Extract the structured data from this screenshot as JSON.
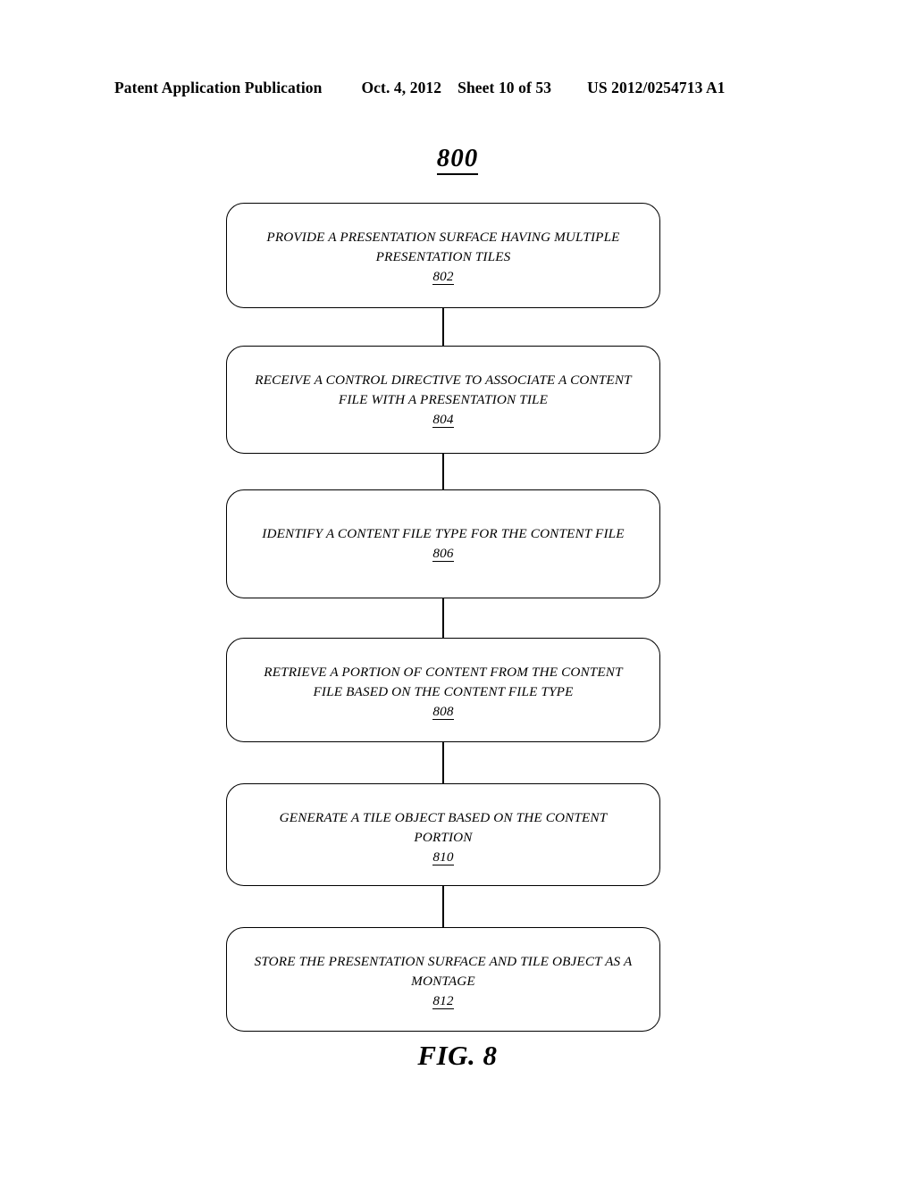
{
  "header": {
    "publication": "Patent Application Publication",
    "date": "Oct. 4, 2012",
    "sheet": "Sheet 10 of 53",
    "document_number": "US 2012/0254713 A1"
  },
  "figure": {
    "reference_number": "800",
    "caption": "FIG. 8"
  },
  "flowchart": {
    "nodes": [
      {
        "id": "802",
        "lines": [
          "PROVIDE A PRESENTATION SURFACE HAVING MULTIPLE",
          "PRESENTATION TILES"
        ],
        "ref": "802"
      },
      {
        "id": "804",
        "lines": [
          "RECEIVE A CONTROL DIRECTIVE TO ASSOCIATE A CONTENT",
          "FILE WITH A PRESENTATION TILE"
        ],
        "ref": "804"
      },
      {
        "id": "806",
        "lines": [
          "IDENTIFY A CONTENT FILE TYPE FOR THE CONTENT FILE"
        ],
        "ref": "806"
      },
      {
        "id": "808",
        "lines": [
          "RETRIEVE A PORTION OF CONTENT FROM THE CONTENT",
          "FILE BASED ON THE CONTENT FILE TYPE"
        ],
        "ref": "808"
      },
      {
        "id": "810",
        "lines": [
          "GENERATE A TILE OBJECT BASED ON THE CONTENT",
          "PORTION"
        ],
        "ref": "810"
      },
      {
        "id": "812",
        "lines": [
          "STORE THE PRESENTATION SURFACE AND TILE OBJECT AS A",
          "MONTAGE"
        ],
        "ref": "812"
      }
    ]
  },
  "colors": {
    "ink": "#000000",
    "page": "#ffffff"
  }
}
